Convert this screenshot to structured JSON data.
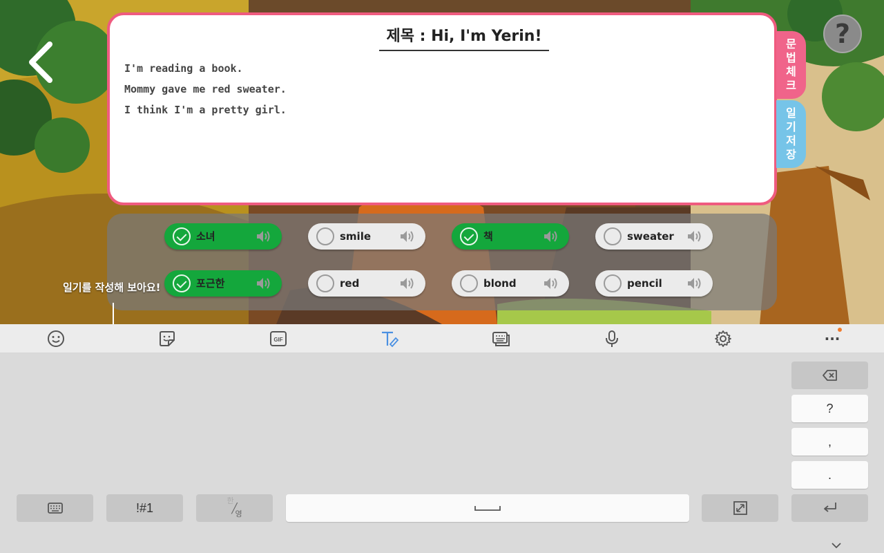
{
  "diary": {
    "title": "제목 : Hi, I'm Yerin!",
    "lines": [
      "I'm reading a book.",
      "Mommy gave me red sweater.",
      "I think I'm a pretty girl."
    ]
  },
  "side_tabs": {
    "grammar_check": [
      "문",
      "법",
      "체",
      "크"
    ],
    "save_diary": [
      "일",
      "기",
      "저",
      "장"
    ]
  },
  "help": {
    "label": "?"
  },
  "words": [
    {
      "text": "소녀",
      "selected": true
    },
    {
      "text": "smile",
      "selected": false
    },
    {
      "text": "책",
      "selected": true
    },
    {
      "text": "sweater",
      "selected": false
    },
    {
      "text": "포근한",
      "selected": true
    },
    {
      "text": "red",
      "selected": false
    },
    {
      "text": "blond",
      "selected": false
    },
    {
      "text": "pencil",
      "selected": false
    }
  ],
  "instruction": "일기를 작성해 보아요!",
  "keyboard": {
    "toolbar": [
      "emoji-icon",
      "sticker-icon",
      "gif-icon",
      "handwriting-icon",
      "keyboard-layout-icon",
      "microphone-icon",
      "settings-icon",
      "more-icon"
    ],
    "gif_label": "GIF",
    "more_label": "···",
    "keys": {
      "question": "?",
      "comma": ",",
      "period": ".",
      "symbols": "!#1",
      "lang_top": "한",
      "lang_bottom": "영",
      "space_label": "␣"
    },
    "accent": "#4a90e2"
  },
  "colors": {
    "card_border": "#ef5b7f",
    "grammar_tab": "#f0648a",
    "save_tab": "#76c4e8",
    "chip_selected": "#14a73c"
  }
}
